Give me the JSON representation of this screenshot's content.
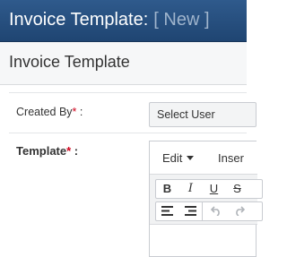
{
  "window": {
    "title": "Invoice Template:",
    "title_suffix": "[ New ]"
  },
  "page": {
    "heading": "Invoice Template"
  },
  "form": {
    "created_by": {
      "label": "Created By",
      "required_mark": "*",
      "suffix": " :",
      "value": "Select User"
    },
    "template": {
      "label": "Template",
      "required_mark": "*",
      "suffix": " :"
    }
  },
  "editor": {
    "menu": {
      "edit": "Edit",
      "insert": "Inser"
    },
    "toolbar": {
      "bold": "B",
      "italic": "I",
      "underline": "U",
      "strikethrough": "S"
    }
  },
  "colors": {
    "titlebar": "#1f4572",
    "required": "#d0021b"
  }
}
